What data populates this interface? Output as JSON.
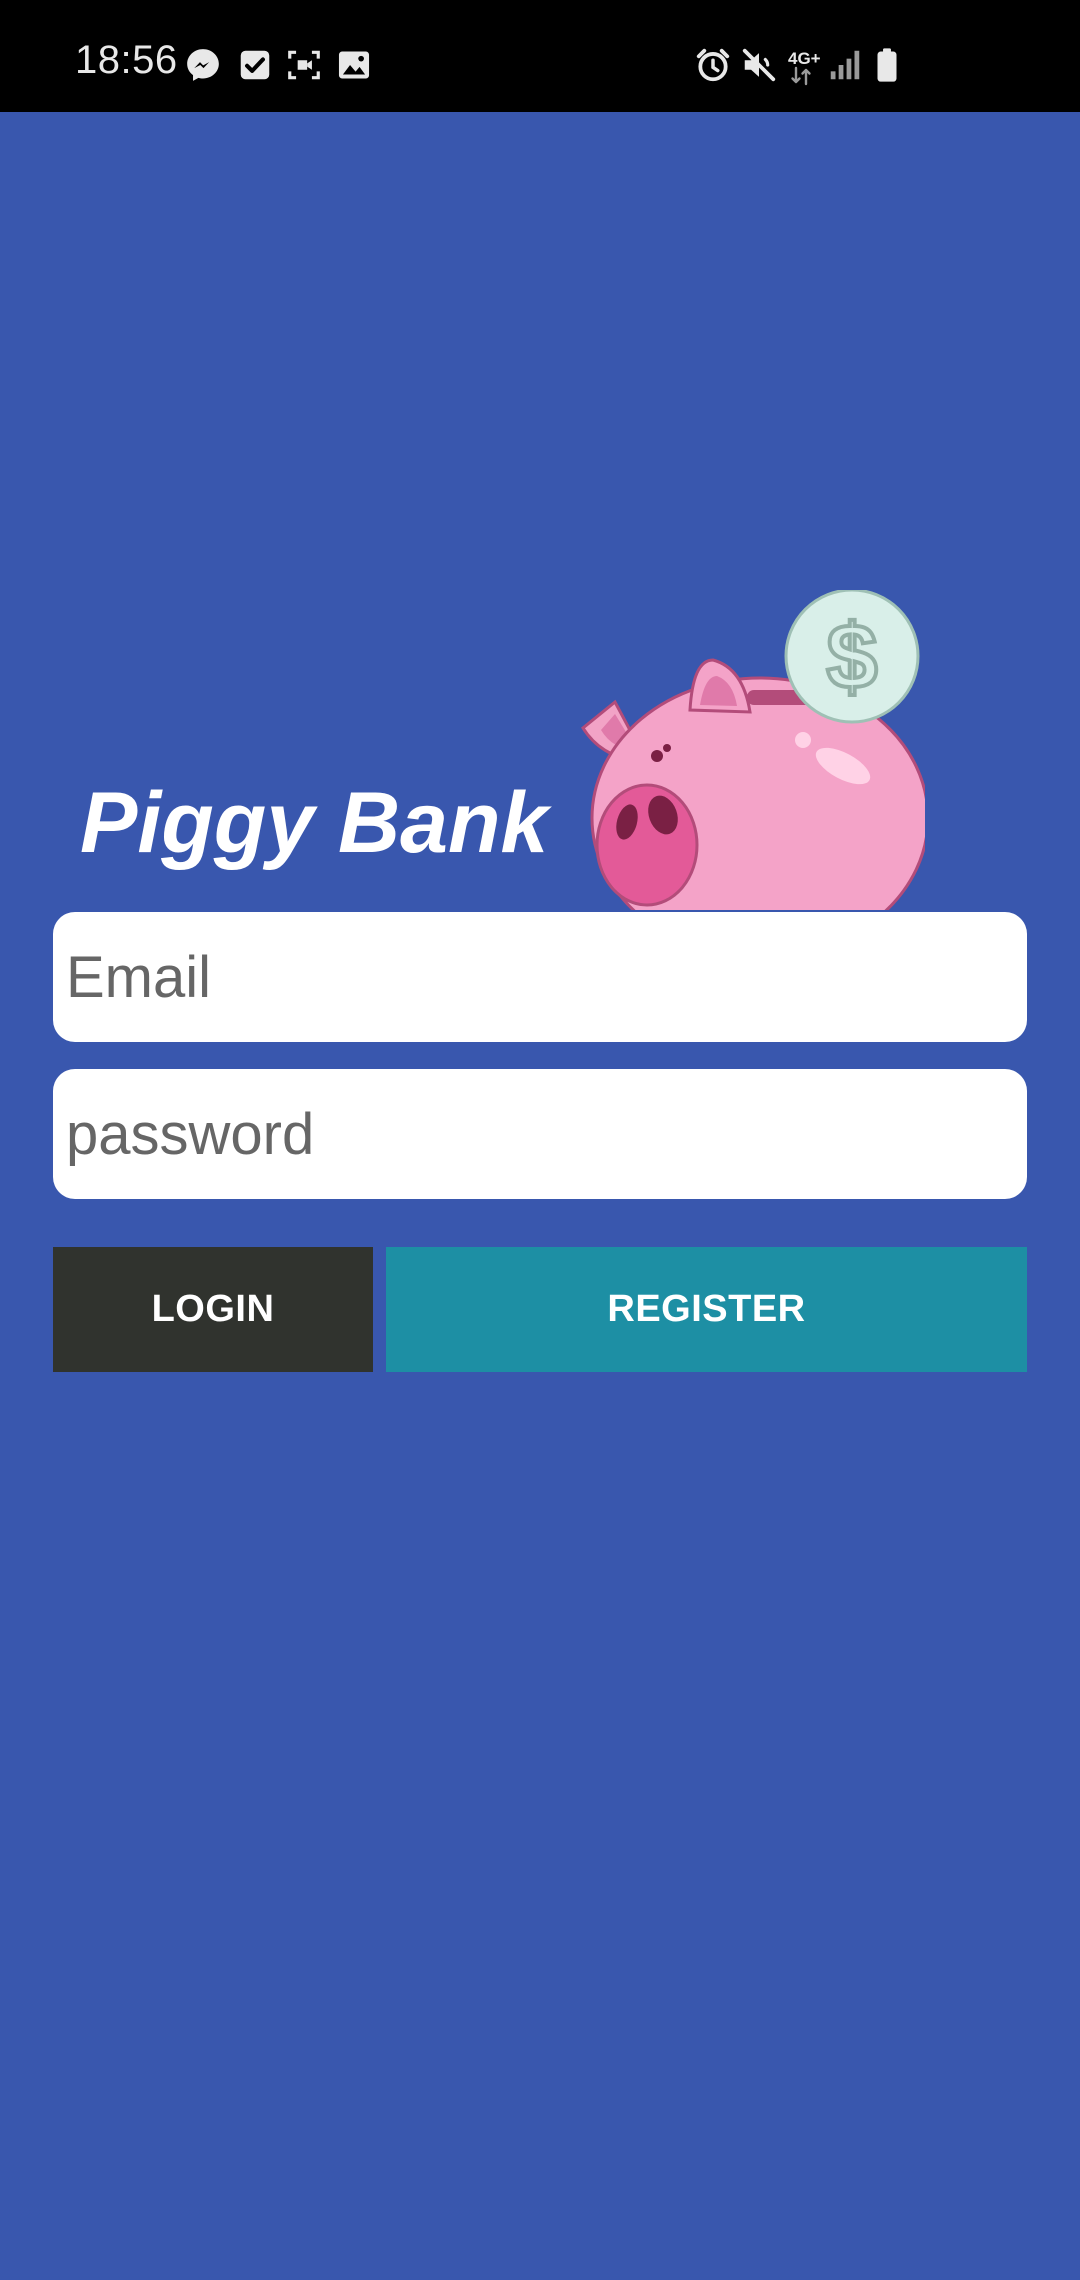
{
  "status_bar": {
    "time": "18:56",
    "network": "4G+",
    "left_icons": [
      "messenger-icon",
      "checkbox-icon",
      "screen-record-icon",
      "image-icon"
    ],
    "right_icons": [
      "alarm-icon",
      "mute-icon",
      "network-4g-icon",
      "signal-icon",
      "battery-icon"
    ]
  },
  "app": {
    "title": "Piggy Bank",
    "logo": "piggy-bank-icon"
  },
  "form": {
    "email_placeholder": "Email",
    "password_placeholder": "password",
    "login_label": "LOGIN",
    "register_label": "REGISTER"
  },
  "colors": {
    "background": "#3957AE",
    "login_button": "#30332E",
    "register_button": "#1D8FA4",
    "status_bar": "#000000"
  }
}
